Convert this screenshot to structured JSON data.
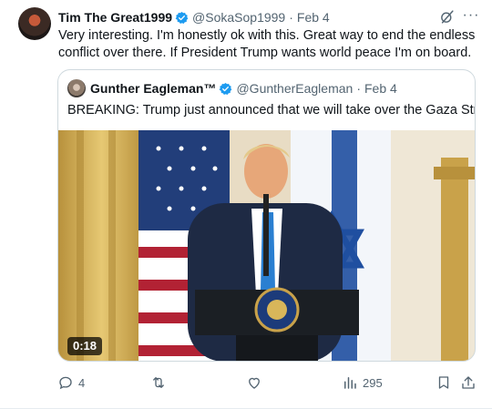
{
  "tweet": {
    "name": "Tim The Great1999",
    "handle": "@SokaSop1999",
    "separator": "·",
    "date": "Feb 4",
    "text": "Very interesting. I'm honestly ok with this. Great way to end the endless conflict over there. If President Trump wants world peace I'm on board.",
    "more_label": "···"
  },
  "quote": {
    "name": "Gunther Eagleman™",
    "handle": "@GuntherEagleman",
    "separator": "·",
    "date": "Feb 4",
    "text": "BREAKING: Trump just announced that we will take over the Gaza Strip.",
    "video_duration": "0:18"
  },
  "actions": {
    "replies": "4",
    "reposts": "",
    "likes": "",
    "views": "295"
  },
  "colors": {
    "text_primary": "#0f1419",
    "text_secondary": "#536471",
    "verified": "#1d9bf0",
    "border": "#cfd9de"
  },
  "icons": [
    "verified-badge-icon",
    "grok-icon",
    "more-icon",
    "reply-icon",
    "repost-icon",
    "like-icon",
    "views-icon",
    "bookmark-icon",
    "share-icon"
  ]
}
